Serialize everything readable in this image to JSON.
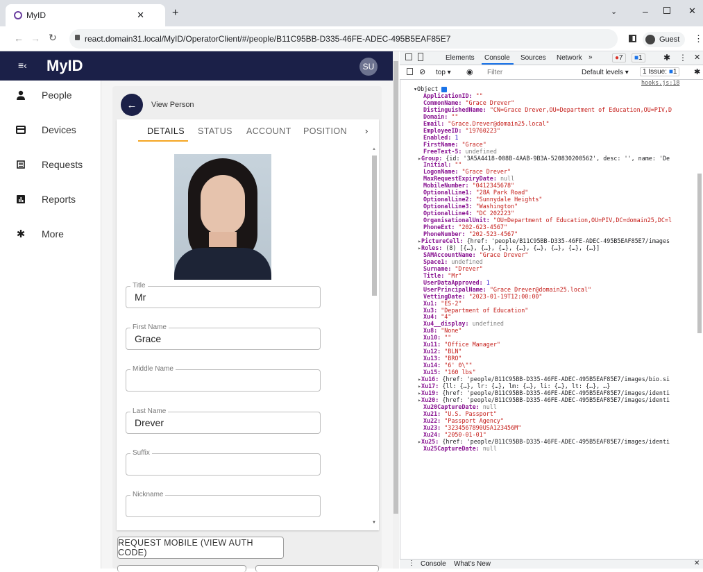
{
  "browser": {
    "tab_title": "MyID",
    "url": "react.domain31.local/MyID/OperatorClient/#/people/B11C95BB-D335-46FE-ADEC-495B5EAF85E7",
    "profile_label": "Guest"
  },
  "app": {
    "title": "MyID",
    "avatar_initials": "SU",
    "nav": [
      {
        "label": "People",
        "icon": "person-icon"
      },
      {
        "label": "Devices",
        "icon": "card-icon"
      },
      {
        "label": "Requests",
        "icon": "list-icon"
      },
      {
        "label": "Reports",
        "icon": "chart-icon"
      },
      {
        "label": "More",
        "icon": "gear-icon"
      }
    ],
    "page_title": "View Person",
    "tabs": [
      "DETAILS",
      "STATUS",
      "ACCOUNT",
      "POSITION"
    ],
    "fields": [
      {
        "label": "Title",
        "value": "Mr"
      },
      {
        "label": "First Name",
        "value": "Grace"
      },
      {
        "label": "Middle Name",
        "value": ""
      },
      {
        "label": "Last Name",
        "value": "Drever"
      },
      {
        "label": "Suffix",
        "value": ""
      },
      {
        "label": "Nickname",
        "value": ""
      }
    ],
    "request_button": "REQUEST MOBILE (VIEW AUTH CODE)"
  },
  "devtools": {
    "tabs": [
      "Elements",
      "Console",
      "Sources",
      "Network"
    ],
    "active_tab": "Console",
    "error_count": "7",
    "message_count": "1",
    "context": "top",
    "filter_placeholder": "Filter",
    "levels": "Default levels",
    "issues": "1 Issue:",
    "issues_count": "1",
    "source_link": "hooks.js:18",
    "object_label": "Object",
    "footer_tabs": [
      "Console",
      "What's New"
    ],
    "lines": [
      {
        "k": "ApplicationID",
        "v": "\"\"",
        "t": "s"
      },
      {
        "k": "CommonName",
        "v": "\"Grace Drever\"",
        "t": "s"
      },
      {
        "k": "DistinguishedName",
        "v": "\"CN=Grace Drever,OU=Department of Education,OU=PIV,D",
        "t": "s"
      },
      {
        "k": "Domain",
        "v": "\"\"",
        "t": "s"
      },
      {
        "k": "Email",
        "v": "\"Grace.Drever@domain25.local\"",
        "t": "s"
      },
      {
        "k": "EmployeeID",
        "v": "\"19760223\"",
        "t": "s"
      },
      {
        "k": "Enabled",
        "v": "1",
        "t": "n"
      },
      {
        "k": "FirstName",
        "v": "\"Grace\"",
        "t": "s"
      },
      {
        "k": "FreeText-5",
        "v": "undefined",
        "t": "u"
      },
      {
        "k": "Group",
        "v": "{id: '3A5A4418-008B-4AAB-9B3A-520830200562', desc: '', name: 'De",
        "t": "o",
        "x": true
      },
      {
        "k": "Initial",
        "v": "\"\"",
        "t": "s"
      },
      {
        "k": "LogonName",
        "v": "\"Grace Drever\"",
        "t": "s"
      },
      {
        "k": "MaxRequestExpiryDate",
        "v": "null",
        "t": "u"
      },
      {
        "k": "MobileNumber",
        "v": "\"0412345678\"",
        "t": "s"
      },
      {
        "k": "OptionalLine1",
        "v": "\"28A Park Road\"",
        "t": "s"
      },
      {
        "k": "OptionalLine2",
        "v": "\"Sunnydale Heights\"",
        "t": "s"
      },
      {
        "k": "OptionalLine3",
        "v": "\"Washington\"",
        "t": "s"
      },
      {
        "k": "OptionalLine4",
        "v": "\"DC 202223\"",
        "t": "s"
      },
      {
        "k": "OrganisationalUnit",
        "v": "\"OU=Department of Education,OU=PIV,DC=domain25,DC=l",
        "t": "s"
      },
      {
        "k": "PhoneExt",
        "v": "\"202-623-4567\"",
        "t": "s"
      },
      {
        "k": "PhoneNumber",
        "v": "\"202-523-4567\"",
        "t": "s"
      },
      {
        "k": "PictureCell",
        "v": "{href: 'people/B11C95BB-D335-46FE-ADEC-495B5EAF85E7/images",
        "t": "o",
        "x": true
      },
      {
        "k": "Roles",
        "v": "(8) [{…}, {…}, {…}, {…}, {…}, {…}, {…}, {…}]",
        "t": "o",
        "x": true
      },
      {
        "k": "SAMAccountName",
        "v": "\"Grace Drever\"",
        "t": "s"
      },
      {
        "k": "Space1",
        "v": "undefined",
        "t": "u"
      },
      {
        "k": "Surname",
        "v": "\"Drever\"",
        "t": "s"
      },
      {
        "k": "Title",
        "v": "\"Mr\"",
        "t": "s"
      },
      {
        "k": "UserDataApproved",
        "v": "1",
        "t": "n"
      },
      {
        "k": "UserPrincipalName",
        "v": "\"Grace Drever@domain25.local\"",
        "t": "s"
      },
      {
        "k": "VettingDate",
        "v": "\"2023-01-19T12:00:00\"",
        "t": "s"
      },
      {
        "k": "Xu1",
        "v": "\"ES-2\"",
        "t": "s"
      },
      {
        "k": "Xu3",
        "v": "\"Department of Education\"",
        "t": "s"
      },
      {
        "k": "Xu4",
        "v": "\"4\"",
        "t": "s"
      },
      {
        "k": "Xu4__display",
        "v": "undefined",
        "t": "u"
      },
      {
        "k": "Xu8",
        "v": "\"None\"",
        "t": "s"
      },
      {
        "k": "Xu10",
        "v": "\"\"",
        "t": "s"
      },
      {
        "k": "Xu11",
        "v": "\"Office Manager\"",
        "t": "s"
      },
      {
        "k": "Xu12",
        "v": "\"BLN\"",
        "t": "s"
      },
      {
        "k": "Xu13",
        "v": "\"BRO\"",
        "t": "s"
      },
      {
        "k": "Xu14",
        "v": "\"6' 0\\\"\"",
        "t": "s"
      },
      {
        "k": "Xu15",
        "v": "\"160 lbs\"",
        "t": "s"
      },
      {
        "k": "Xu16",
        "v": "{href: 'people/B11C95BB-D335-46FE-ADEC-495B5EAF85E7/images/bio.si",
        "t": "o",
        "x": true
      },
      {
        "k": "Xu17",
        "v": "{ll: {…}, lr: {…}, lm: {…}, li: {…}, lt: {…}, …}",
        "t": "o",
        "x": true
      },
      {
        "k": "Xu19",
        "v": "{href: 'people/B11C95BB-D335-46FE-ADEC-495B5EAF85E7/images/identi",
        "t": "o",
        "x": true
      },
      {
        "k": "Xu20",
        "v": "{href: 'people/B11C95BB-D335-46FE-ADEC-495B5EAF85E7/images/identi",
        "t": "o",
        "x": true
      },
      {
        "k": "Xu20CaptureDate",
        "v": "null",
        "t": "u"
      },
      {
        "k": "Xu21",
        "v": "\"U.S. Passport\"",
        "t": "s"
      },
      {
        "k": "Xu22",
        "v": "\"Passport Agency\"",
        "t": "s"
      },
      {
        "k": "Xu23",
        "v": "\"3234567890USA123456M\"",
        "t": "s"
      },
      {
        "k": "Xu24",
        "v": "\"2050-01-01\"",
        "t": "s"
      },
      {
        "k": "Xu25",
        "v": "{href: 'people/B11C95BB-D335-46FE-ADEC-495B5EAF85E7/images/identi",
        "t": "o",
        "x": true
      },
      {
        "k": "Xu25CaptureDate",
        "v": "null",
        "t": "u"
      }
    ]
  }
}
